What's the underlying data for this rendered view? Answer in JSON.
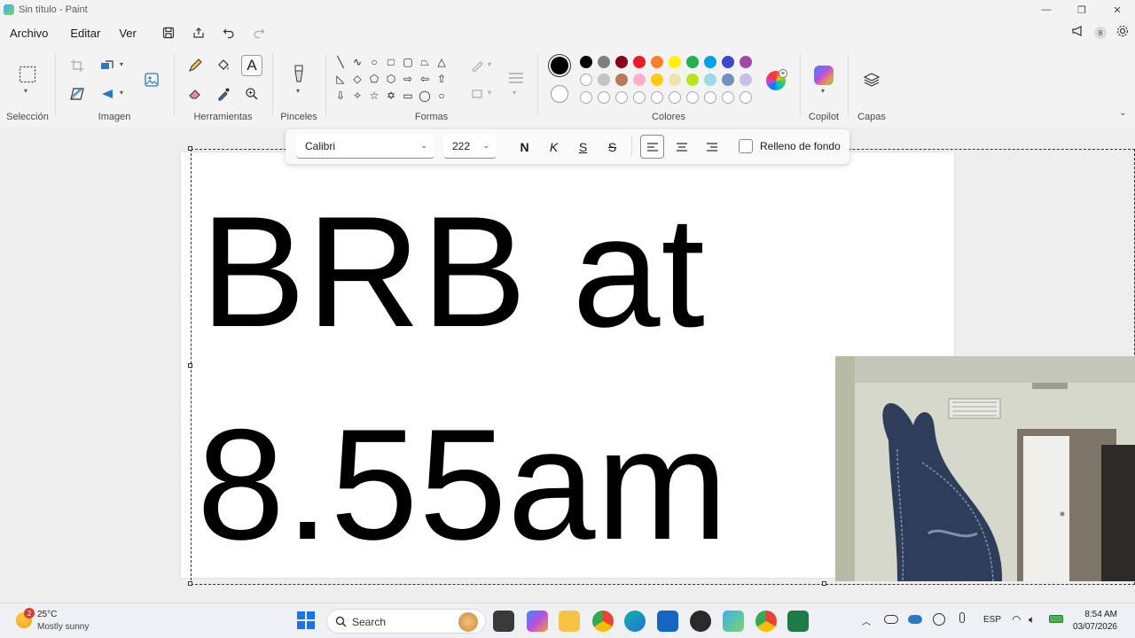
{
  "window": {
    "title": "Sin título - Paint",
    "minimize": "—",
    "restore": "❐",
    "close": "✕"
  },
  "menu": {
    "archivo": "Archivo",
    "editar": "Editar",
    "ver": "Ver",
    "copilot_badge": "8"
  },
  "ribbon": {
    "groups": {
      "seleccion": "Selección",
      "imagen": "Imagen",
      "herramientas": "Herramientas",
      "pinceles": "Pinceles",
      "formas": "Formas",
      "colores": "Colores",
      "copilot": "Copilot",
      "capas": "Capas"
    },
    "palette_row1": [
      "#000000",
      "#7f7f7f",
      "#880015",
      "#ed1c24",
      "#ff7f27",
      "#fff200",
      "#22b14c",
      "#00a2e8",
      "#3f48cc",
      "#a349a4"
    ],
    "palette_row2": [
      "#ffffff",
      "#c3c3c3",
      "#b97a57",
      "#ffaec9",
      "#ffc90e",
      "#efe4b0",
      "#b5e61d",
      "#99d9ea",
      "#7092be",
      "#c8bfe7"
    ],
    "primary_color": "#000000",
    "secondary_color": "#ffffff"
  },
  "text_toolbar": {
    "font": "Calibri",
    "size": "222",
    "bold": "N",
    "italic": "K",
    "underline": "S",
    "strikethrough": "S",
    "fill_label": "Relleno de fondo"
  },
  "canvas": {
    "line1": "BRB at",
    "line2": "8.55am"
  },
  "taskbar": {
    "weather_badge": "2",
    "temperature": "25°C",
    "condition": "Mostly sunny",
    "search_placeholder": "Search",
    "language": "ESP",
    "time": "8:54 AM",
    "date": "03/07/2026"
  }
}
